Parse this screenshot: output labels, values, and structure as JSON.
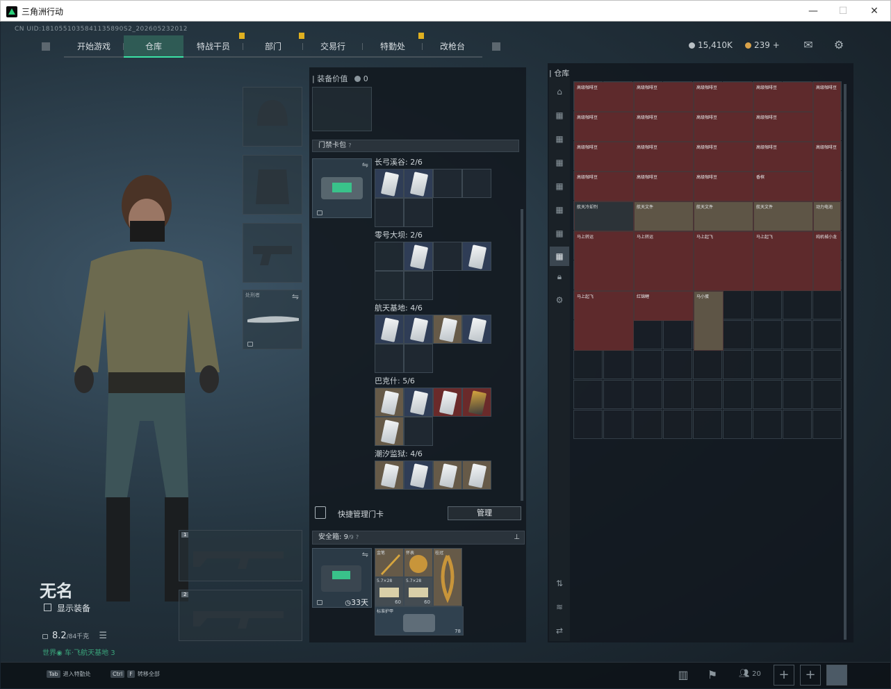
{
  "window": {
    "title": "三角洲行动",
    "minimize": "—",
    "maximize": "☐",
    "close": "✕"
  },
  "header": {
    "uid": "CN UID:1810551035841135890S2_20260523201​2",
    "tabs": [
      {
        "label": "开始游戏",
        "active": false,
        "pin": false
      },
      {
        "label": "仓库",
        "active": true,
        "pin": false
      },
      {
        "label": "特战干员",
        "active": false,
        "pin": true
      },
      {
        "label": "部门",
        "active": false,
        "pin": true
      },
      {
        "label": "交易行",
        "active": false,
        "pin": false
      },
      {
        "label": "特勤处",
        "active": false,
        "pin": true
      },
      {
        "label": "改枪台",
        "active": false,
        "pin": false
      }
    ],
    "currency_a": "15,410K",
    "currency_b": "239",
    "currency_b_plus": "+",
    "mail_icon": "mail-icon",
    "settings_icon": "gear-icon"
  },
  "character": {
    "name": "无名",
    "show_gear": "显示装备",
    "weight": "8.2",
    "weight_max": "/84千克",
    "status_line": "世界◉ 车·飞航天基地 3",
    "melee_label": "处刑者",
    "weapon_slot_1": "1",
    "weapon_slot_2": "2"
  },
  "middle": {
    "equip_value_label": "装备价值",
    "equip_value": "0",
    "keycard_section": "门禁卡包",
    "groups": [
      {
        "name": "长弓溪谷: 2/6"
      },
      {
        "name": "零号大坝: 2/6"
      },
      {
        "name": "航天基地: 4/6"
      },
      {
        "name": "巴克什: 5/6"
      },
      {
        "name": "潮汐监狱: 4/6"
      }
    ],
    "manage_label": "快捷管理门卡",
    "manage_button": "管理",
    "safebox_label": "安全箱:",
    "safebox_value": "9",
    "safebox_max": "/9",
    "safebox_days": "33天",
    "safe_items": [
      {
        "label": "金笔"
      },
      {
        "label": "怀表"
      },
      {
        "label": "桂冠"
      },
      {
        "label": "5.7×28",
        "count": "60"
      },
      {
        "label": "5.7×28",
        "count": "60"
      },
      {
        "label": "标准护甲",
        "count": "78"
      }
    ]
  },
  "warehouse": {
    "title": "仓库",
    "coffee_label": "高级咖啡豆",
    "items": [
      {
        "label": "香槟"
      },
      {
        "label": "航天冷却剂"
      },
      {
        "label": "航天文件"
      },
      {
        "label": "航天文件"
      },
      {
        "label": "航天文件"
      },
      {
        "label": "动力电池"
      },
      {
        "label": "马上转运"
      },
      {
        "label": "马上转运"
      },
      {
        "label": "马上起飞"
      },
      {
        "label": "马上起飞"
      },
      {
        "label": "纯机械小龙"
      },
      {
        "label": "马上起飞"
      },
      {
        "label": "红锦鲤"
      },
      {
        "label": "马小蛋"
      }
    ]
  },
  "bottombar": {
    "key1": "Tab",
    "hint1": "进入特勤处",
    "key2": "Ctrl",
    "key2b": "F",
    "hint2": "转移全部",
    "squad_count": "20"
  }
}
